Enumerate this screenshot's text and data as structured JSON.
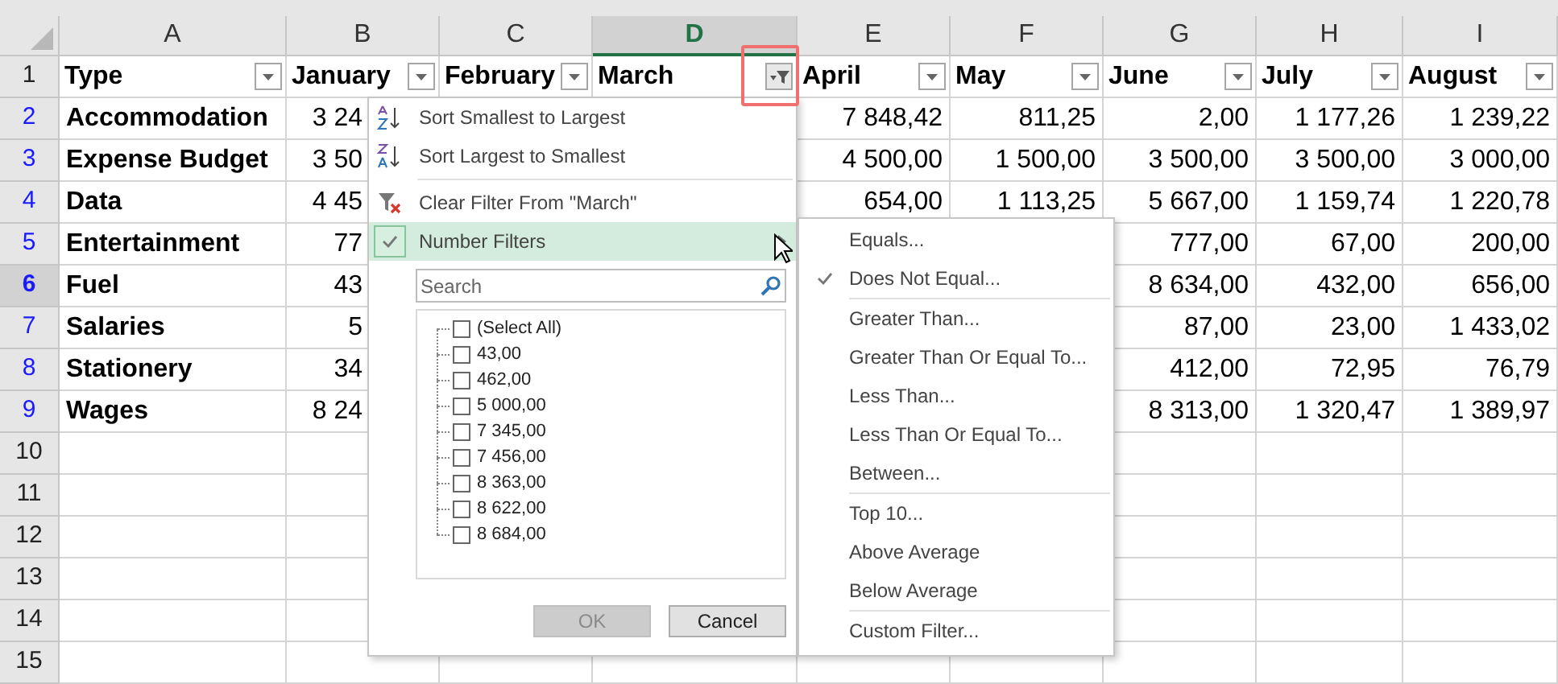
{
  "columns": [
    {
      "letter": "A",
      "selected": false
    },
    {
      "letter": "B",
      "selected": false
    },
    {
      "letter": "C",
      "selected": false
    },
    {
      "letter": "D",
      "selected": true
    },
    {
      "letter": "E",
      "selected": false
    },
    {
      "letter": "F",
      "selected": false
    },
    {
      "letter": "G",
      "selected": false
    },
    {
      "letter": "H",
      "selected": false
    },
    {
      "letter": "I",
      "selected": false
    }
  ],
  "header_row": {
    "number": "1",
    "selected": false,
    "filtered": false,
    "cells": [
      {
        "text": "Type",
        "filtered": false,
        "highlighted": false
      },
      {
        "text": "January",
        "filtered": false,
        "highlighted": false
      },
      {
        "text": "February",
        "filtered": false,
        "highlighted": false
      },
      {
        "text": "March",
        "filtered": true,
        "highlighted": true
      },
      {
        "text": "April",
        "filtered": false,
        "highlighted": false
      },
      {
        "text": "May",
        "filtered": false,
        "highlighted": false
      },
      {
        "text": "June",
        "filtered": false,
        "highlighted": false
      },
      {
        "text": "July",
        "filtered": false,
        "highlighted": false
      },
      {
        "text": "August",
        "filtered": false,
        "highlighted": false
      }
    ]
  },
  "rows": [
    {
      "number": "2",
      "selected": false,
      "filtered": true,
      "cells": [
        "Accommodation",
        "3 24",
        null,
        null,
        "7 848,42",
        "811,25",
        "2,00",
        "1 177,26",
        "1 239,22"
      ]
    },
    {
      "number": "3",
      "selected": false,
      "filtered": true,
      "cells": [
        "Expense Budget",
        "3 50",
        null,
        null,
        "4 500,00",
        "1 500,00",
        "3 500,00",
        "3 500,00",
        "3 000,00"
      ]
    },
    {
      "number": "4",
      "selected": false,
      "filtered": true,
      "cells": [
        "Data",
        "4 45",
        null,
        null,
        "654,00",
        "1 113,25",
        "5 667,00",
        "1 159,74",
        "1 220,78"
      ]
    },
    {
      "number": "5",
      "selected": false,
      "filtered": true,
      "cells": [
        "Entertainment",
        "77",
        null,
        null,
        null,
        null,
        "777,00",
        "67,00",
        "200,00"
      ]
    },
    {
      "number": "6",
      "selected": true,
      "filtered": true,
      "cells": [
        "Fuel",
        "43",
        null,
        null,
        null,
        null,
        "8 634,00",
        "432,00",
        "656,00"
      ]
    },
    {
      "number": "7",
      "selected": false,
      "filtered": true,
      "cells": [
        "Salaries",
        "5",
        null,
        null,
        null,
        null,
        "87,00",
        "23,00",
        "1 433,02"
      ]
    },
    {
      "number": "8",
      "selected": false,
      "filtered": true,
      "cells": [
        "Stationery",
        "34",
        null,
        null,
        null,
        null,
        "412,00",
        "72,95",
        "76,79"
      ]
    },
    {
      "number": "9",
      "selected": false,
      "filtered": true,
      "cells": [
        "Wages",
        "8 24",
        null,
        null,
        null,
        null,
        "8 313,00",
        "1 320,47",
        "1 389,97"
      ]
    },
    {
      "number": "10",
      "selected": false,
      "filtered": false,
      "cells": []
    },
    {
      "number": "11",
      "selected": false,
      "filtered": false,
      "cells": []
    },
    {
      "number": "12",
      "selected": false,
      "filtered": false,
      "cells": []
    },
    {
      "number": "13",
      "selected": false,
      "filtered": false,
      "cells": []
    },
    {
      "number": "14",
      "selected": false,
      "filtered": false,
      "cells": []
    },
    {
      "number": "15",
      "selected": false,
      "filtered": false,
      "cells": []
    }
  ],
  "filter_menu": {
    "items": [
      {
        "kind": "sort_asc",
        "label": "Sort Smallest to Largest"
      },
      {
        "kind": "sort_desc",
        "label": "Sort Largest to Smallest"
      },
      {
        "kind": "clear",
        "label": "Clear Filter From \"March\""
      },
      {
        "kind": "submenu",
        "label": "Number Filters",
        "checked": true,
        "highlighted": true
      }
    ],
    "search": {
      "placeholder": "Search"
    },
    "values": [
      {
        "label": "(Select All)",
        "checked": false
      },
      {
        "label": "43,00",
        "checked": false
      },
      {
        "label": "462,00",
        "checked": false
      },
      {
        "label": "5 000,00",
        "checked": false
      },
      {
        "label": "7 345,00",
        "checked": false
      },
      {
        "label": "7 456,00",
        "checked": false
      },
      {
        "label": "8 363,00",
        "checked": false
      },
      {
        "label": "8 622,00",
        "checked": false
      },
      {
        "label": "8 684,00",
        "checked": false
      }
    ],
    "buttons": [
      {
        "label": "OK",
        "disabled": true
      },
      {
        "label": "Cancel",
        "disabled": false
      }
    ]
  },
  "number_filters_menu": {
    "groups": [
      [
        {
          "label": "Equals...",
          "checked": false
        },
        {
          "label": "Does Not Equal...",
          "checked": true
        }
      ],
      [
        {
          "label": "Greater Than...",
          "checked": false
        },
        {
          "label": "Greater Than Or Equal To...",
          "checked": false
        },
        {
          "label": "Less Than...",
          "checked": false
        },
        {
          "label": "Less Than Or Equal To...",
          "checked": false
        },
        {
          "label": "Between...",
          "checked": false
        }
      ],
      [
        {
          "label": "Top 10...",
          "checked": false
        },
        {
          "label": "Above Average",
          "checked": false
        },
        {
          "label": "Below Average",
          "checked": false
        }
      ],
      [
        {
          "label": "Custom Filter...",
          "checked": false
        }
      ]
    ]
  }
}
